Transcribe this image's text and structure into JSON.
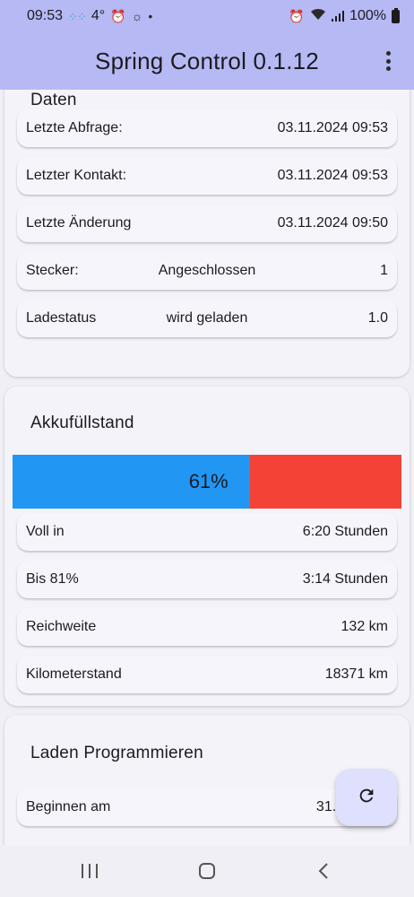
{
  "status_bar": {
    "time": "09:53",
    "temperature": "4°",
    "battery_percent": "100%",
    "icons": [
      "cloud-dots-icon",
      "alarm-icon",
      "weather-icon",
      "dot-icon",
      "alarm-icon",
      "wifi-icon",
      "signal-icon",
      "battery-icon"
    ]
  },
  "app_bar": {
    "title": "Spring Control 0.1.12",
    "menu_icon": "more-vert-icon"
  },
  "daten": {
    "title": "Daten",
    "rows": [
      {
        "label": "Letzte Abfrage:",
        "middle": "",
        "value": "03.11.2024 09:53"
      },
      {
        "label": "Letzter Kontakt:",
        "middle": "",
        "value": "03.11.2024 09:53"
      },
      {
        "label": "Letzte Änderung",
        "middle": "",
        "value": "03.11.2024 09:50"
      },
      {
        "label": "Stecker:",
        "middle": "Angeschlossen",
        "value": "1"
      },
      {
        "label": "Ladestatus",
        "middle": "wird geladen",
        "value": "1.0"
      }
    ]
  },
  "akku": {
    "title": "Akkufüllstand",
    "level_label": "61%",
    "level_fraction": 0.61,
    "fill_color": "#2196f3",
    "rest_color": "#f44336",
    "rows": [
      {
        "label": "Voll in",
        "value": "6:20 Stunden"
      },
      {
        "label": "Bis 81%",
        "value": "3:14 Stunden"
      },
      {
        "label": "Reichweite",
        "value": "132 km"
      },
      {
        "label": "Kilometerstand",
        "value": "18371 km"
      }
    ]
  },
  "laden": {
    "title": "Laden Programmieren",
    "rows": [
      {
        "label": "Beginnen am",
        "value": "31.10.2024"
      }
    ]
  },
  "fab": {
    "icon": "refresh-icon"
  },
  "nav_bar": {
    "items": [
      "recents-icon",
      "home-icon",
      "back-icon"
    ]
  },
  "colors": {
    "app_bar": "#b6b9f4",
    "background": "#f0eff6",
    "fab": "#dfe0fd"
  }
}
